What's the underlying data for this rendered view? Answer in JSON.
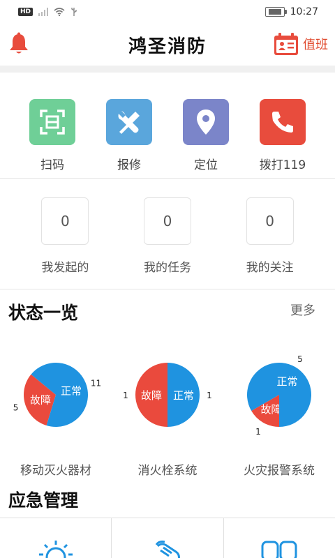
{
  "statusbar": {
    "network_badge": "HD",
    "time": "10:27"
  },
  "header": {
    "title": "鸿圣消防",
    "duty_label": "值班"
  },
  "actions": [
    {
      "label": "扫码",
      "icon": "scan-icon",
      "color": "#6fcf97"
    },
    {
      "label": "报修",
      "icon": "tools-icon",
      "color": "#5aa6dc"
    },
    {
      "label": "定位",
      "icon": "location-pin-icon",
      "color": "#7b85c9"
    },
    {
      "label": "拨打119",
      "icon": "phone-icon",
      "color": "#e84c3d"
    }
  ],
  "tasks": [
    {
      "value": "0",
      "label": "我发起的"
    },
    {
      "value": "0",
      "label": "我的任务"
    },
    {
      "value": "0",
      "label": "我的关注"
    }
  ],
  "status_section": {
    "title": "状态一览",
    "more": "更多"
  },
  "emergency_section": {
    "title": "应急管理"
  },
  "chart_data": [
    {
      "type": "pie",
      "title": "移动灭火器材",
      "slices": [
        {
          "label": "故障",
          "value": 5,
          "color": "#ea4a3d"
        },
        {
          "label": "正常",
          "value": 11,
          "color": "#1f93e0"
        }
      ]
    },
    {
      "type": "pie",
      "title": "消火栓系统",
      "slices": [
        {
          "label": "故障",
          "value": 1,
          "color": "#ea4a3d"
        },
        {
          "label": "正常",
          "value": 1,
          "color": "#1f93e0"
        }
      ]
    },
    {
      "type": "pie",
      "title": "火灾报警系统",
      "slices": [
        {
          "label": "故障",
          "value": 1,
          "color": "#ea4a3d"
        },
        {
          "label": "正常",
          "value": 5,
          "color": "#1f93e0"
        }
      ]
    }
  ]
}
